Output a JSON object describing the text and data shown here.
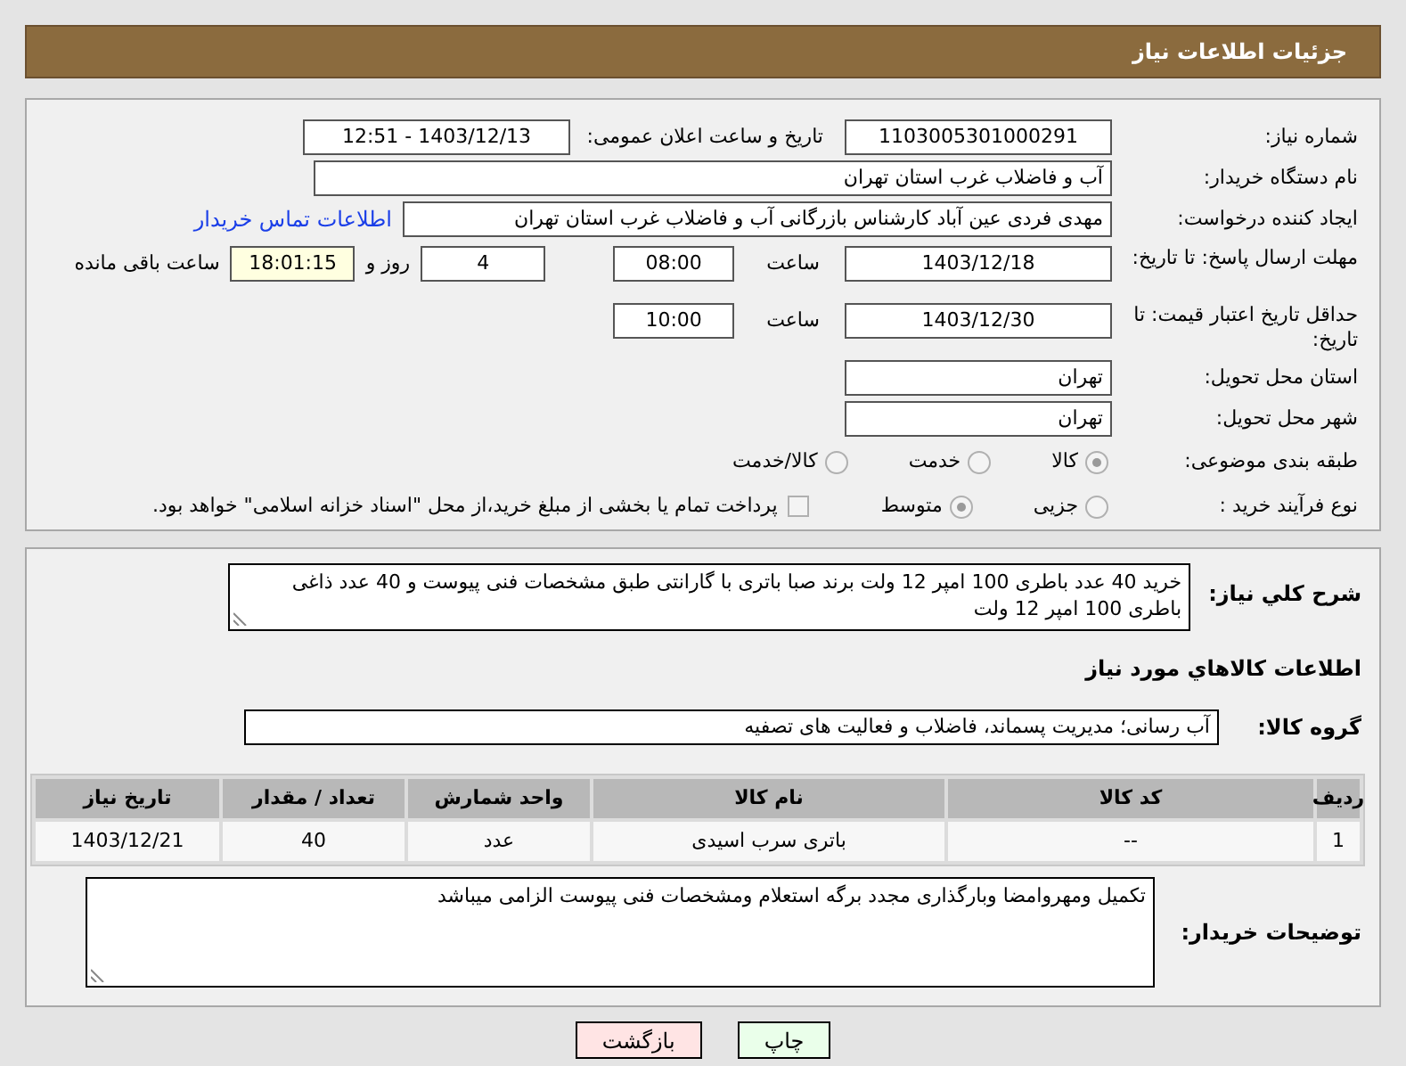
{
  "header": {
    "title": "جزئیات اطلاعات نیاز"
  },
  "details": {
    "need_number": {
      "label": "شماره نیاز:",
      "value": "1103005301000291"
    },
    "announce": {
      "label": "تاریخ و ساعت اعلان عمومی:",
      "value": "1403/12/13 - 12:51"
    },
    "buyer_org": {
      "label": "نام دستگاه خریدار:",
      "value": "آب و فاضلاب غرب استان تهران"
    },
    "requester": {
      "label": "ایجاد کننده درخواست:",
      "value": "مهدی فردی عین آباد کارشناس بازرگانی آب و فاضلاب غرب استان تهران",
      "link": "اطلاعات تماس خریدار"
    },
    "reply_deadline": {
      "label": "مهلت ارسال پاسخ: تا تاریخ:",
      "date": "1403/12/18",
      "time_label": "ساعت",
      "time": "08:00",
      "days": "4",
      "days_label": "روز و",
      "remaining": "18:01:15",
      "remaining_label": "ساعت باقی مانده"
    },
    "price_validity": {
      "label": "حداقل تاریخ اعتبار قیمت: تا تاریخ:",
      "date": "1403/12/30",
      "time_label": "ساعت",
      "time": "10:00"
    },
    "province": {
      "label": "استان محل تحویل:",
      "value": "تهران"
    },
    "city": {
      "label": "شهر محل تحویل:",
      "value": "تهران"
    },
    "category": {
      "label": "طبقه بندی موضوعی:",
      "options": [
        {
          "label": "کالا",
          "selected": true
        },
        {
          "label": "خدمت",
          "selected": false
        },
        {
          "label": "کالا/خدمت",
          "selected": false
        }
      ]
    },
    "process": {
      "label": "نوع فرآیند خرید :",
      "options": [
        {
          "label": "جزیی",
          "selected": false
        },
        {
          "label": "متوسط",
          "selected": true
        }
      ],
      "treasury": {
        "checked": false,
        "text": "پرداخت تمام یا بخشی از مبلغ خرید،از محل \"اسناد خزانه اسلامی\" خواهد بود."
      }
    }
  },
  "description": {
    "label": "شرح کلي نياز:",
    "value": "خرید 40 عدد باطری 100 امپر 12 ولت برند صبا باتری با گارانتی طبق مشخصات فنی پیوست و 40 عدد ذاغی باطری 100 امپر 12 ولت"
  },
  "goods": {
    "title": "اطلاعات کالاهاي مورد نياز",
    "group_label": "گروه کالا:",
    "group_value": "آب رسانی؛ مدیریت پسماند، فاضلاب و فعالیت های تصفیه",
    "table": {
      "columns": [
        "ردیف",
        "کد کالا",
        "نام کالا",
        "واحد شمارش",
        "تعداد / مقدار",
        "تاریخ نیاز"
      ],
      "rows": [
        [
          "1",
          "--",
          "باتری سرب اسیدی",
          "عدد",
          "40",
          "1403/12/21"
        ]
      ]
    }
  },
  "buyer_notes": {
    "label": "توضیحات خریدار:",
    "value": "تکمیل ومهروامضا وبارگذاری مجدد برگه استعلام ومشخصات فنی پیوست الزامی میباشد"
  },
  "buttons": [
    {
      "label": "چاپ",
      "kind": "print"
    },
    {
      "label": "بازگشت",
      "kind": "back"
    }
  ]
}
